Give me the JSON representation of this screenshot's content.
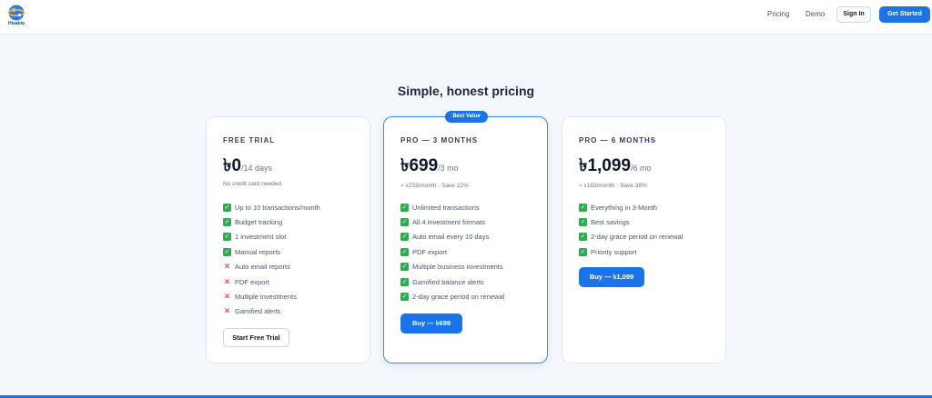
{
  "header": {
    "logo_text": "Hisabio",
    "nav": {
      "pricing": "Pricing",
      "demo": "Demo"
    },
    "sign_in": "Sign In",
    "get_started": "Get Started"
  },
  "heading": "Simple, honest pricing",
  "plans": [
    {
      "name": "FREE TRIAL",
      "price": "৳0",
      "period": "/14 days",
      "subtext": "No credit card needed",
      "features": [
        {
          "text": "Up to 10 transactions/month",
          "included": true
        },
        {
          "text": "Budget tracking",
          "included": true
        },
        {
          "text": "1 investment slot",
          "included": true
        },
        {
          "text": "Manual reports",
          "included": true
        },
        {
          "text": "Auto email reports",
          "included": false
        },
        {
          "text": "PDF export",
          "included": false
        },
        {
          "text": "Multiple investments",
          "included": false
        },
        {
          "text": "Gamified alerts",
          "included": false
        }
      ],
      "cta": "Start Free Trial"
    },
    {
      "badge": "Best Value",
      "name": "PRO — 3 MONTHS",
      "price": "৳699",
      "period": "/3 mo",
      "subtext": "≈ ৳233/month · Save 22%",
      "features": [
        {
          "text": "Unlimited transactions",
          "included": true
        },
        {
          "text": "All 4 investment formats",
          "included": true
        },
        {
          "text": "Auto email every 10 days",
          "included": true
        },
        {
          "text": "PDF export",
          "included": true
        },
        {
          "text": "Multiple business investments",
          "included": true
        },
        {
          "text": "Gamified balance alerts",
          "included": true
        },
        {
          "text": "2-day grace period on renewal",
          "included": true
        }
      ],
      "cta": "Buy — ৳699"
    },
    {
      "name": "PRO — 6 MONTHS",
      "price": "৳1,099",
      "period": "/6 mo",
      "subtext": "≈ ৳183/month · Save 38%",
      "features": [
        {
          "text": "Everything in 3-Month",
          "included": true
        },
        {
          "text": "Best savings",
          "included": true
        },
        {
          "text": "2-day grace period on renewal",
          "included": true
        },
        {
          "text": "Priority support",
          "included": true
        }
      ],
      "cta": "Buy — ৳1,099"
    }
  ],
  "colors": {
    "accent": "#1a73e8",
    "check": "#34a853",
    "cross": "#c0392b",
    "background": "#f4f7fb"
  },
  "icons": {
    "check": "check-icon",
    "cross": "cross-icon",
    "logo": "globe-logo-icon"
  }
}
